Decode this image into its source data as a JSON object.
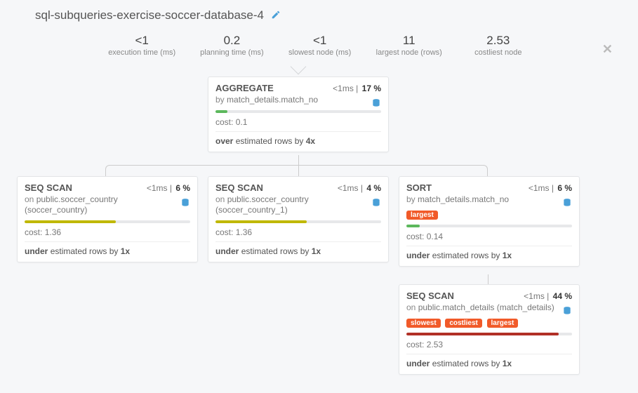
{
  "title": "sql-subqueries-exercise-soccer-database-4",
  "stats": [
    {
      "value": "<1",
      "label": "execution time (ms)"
    },
    {
      "value": "0.2",
      "label": "planning time (ms)"
    },
    {
      "value": "<1",
      "label": "slowest node (ms)"
    },
    {
      "value": "11",
      "label": "largest node (rows)"
    },
    {
      "value": "2.53",
      "label": "costliest node"
    }
  ],
  "nodes": {
    "agg": {
      "op": "AGGREGATE",
      "time": "<1ms",
      "pct": "17 %",
      "sub_prefix": "by",
      "sub": "match_details.match_no",
      "cost_label": "cost:",
      "cost": "0.1",
      "bar_pct": 7,
      "bar_class": "bar-green",
      "est_bold": "over",
      "est_rest": "estimated rows by",
      "est_mult": "4x"
    },
    "scan1": {
      "op": "SEQ SCAN",
      "time": "<1ms",
      "pct": "6 %",
      "sub_prefix": "on",
      "sub": "public.soccer_country (soccer_country)",
      "cost_label": "cost:",
      "cost": "1.36",
      "bar_pct": 55,
      "bar_class": "bar-olive",
      "est_bold": "under",
      "est_rest": "estimated rows by",
      "est_mult": "1x"
    },
    "scan2": {
      "op": "SEQ SCAN",
      "time": "<1ms",
      "pct": "4 %",
      "sub_prefix": "on",
      "sub": "public.soccer_country (soccer_country_1)",
      "cost_label": "cost:",
      "cost": "1.36",
      "bar_pct": 55,
      "bar_class": "bar-olive",
      "est_bold": "under",
      "est_rest": "estimated rows by",
      "est_mult": "1x"
    },
    "sort": {
      "op": "SORT",
      "time": "<1ms",
      "pct": "6 %",
      "sub_prefix": "by",
      "sub": "match_details.match_no",
      "tags": [
        "largest"
      ],
      "cost_label": "cost:",
      "cost": "0.14",
      "bar_pct": 8,
      "bar_class": "bar-green",
      "est_bold": "under",
      "est_rest": "estimated rows by",
      "est_mult": "1x"
    },
    "scan3": {
      "op": "SEQ SCAN",
      "time": "<1ms",
      "pct": "44 %",
      "sub_prefix": "on",
      "sub": "public.match_details (match_details)",
      "tags": [
        "slowest",
        "costliest",
        "largest"
      ],
      "cost_label": "cost:",
      "cost": "2.53",
      "bar_pct": 92,
      "bar_class": "bar-red",
      "est_bold": "under",
      "est_rest": "estimated rows by",
      "est_mult": "1x"
    }
  }
}
